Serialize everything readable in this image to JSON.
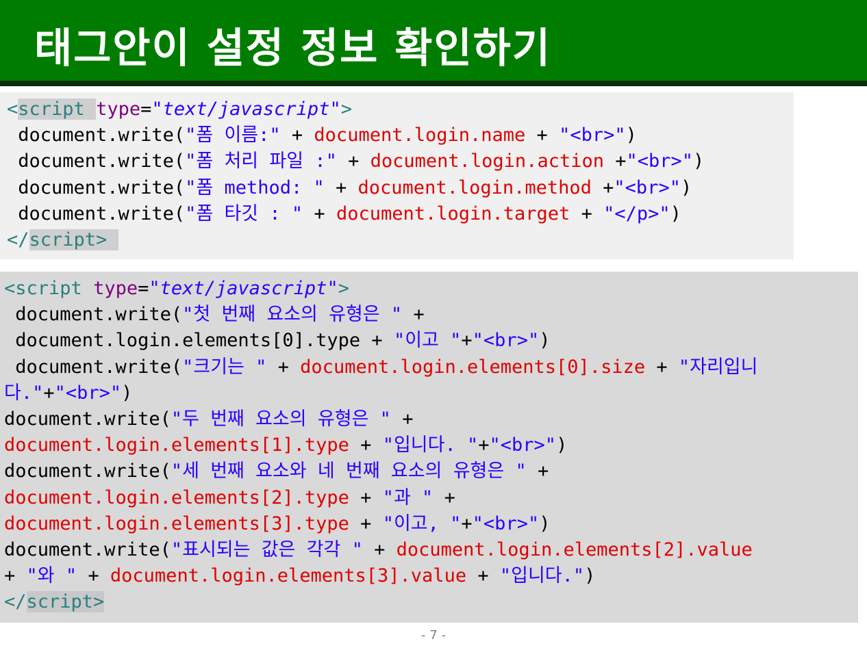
{
  "title": "태그안이 설정 정보 확인하기",
  "page_number": "- 7 -",
  "block1": [
    [
      {
        "t": "<",
        "c": "tag"
      },
      {
        "t": "script ",
        "c": "tagbg"
      },
      {
        "t": "type",
        "c": "attr"
      },
      {
        "t": "=",
        "c": ""
      },
      {
        "t": "\"text/javascript\"",
        "c": "val"
      },
      {
        "t": ">",
        "c": "tag"
      }
    ],
    [
      {
        "t": " document.write(",
        "c": ""
      },
      {
        "t": "\"폼 이름:\"",
        "c": "str"
      },
      {
        "t": " + ",
        "c": ""
      },
      {
        "t": "document.login.name",
        "c": "red"
      },
      {
        "t": " + ",
        "c": ""
      },
      {
        "t": "\"<br>\"",
        "c": "str"
      },
      {
        "t": ")",
        "c": ""
      }
    ],
    [
      {
        "t": " document.write(",
        "c": ""
      },
      {
        "t": "\"폼 처리 파일 :\"",
        "c": "str"
      },
      {
        "t": " + ",
        "c": ""
      },
      {
        "t": "document.login.action",
        "c": "red"
      },
      {
        "t": " +",
        "c": ""
      },
      {
        "t": "\"<br>\"",
        "c": "str"
      },
      {
        "t": ")",
        "c": ""
      }
    ],
    [
      {
        "t": " document.write(",
        "c": ""
      },
      {
        "t": "\"폼 method: \"",
        "c": "str"
      },
      {
        "t": " + ",
        "c": ""
      },
      {
        "t": "document.login.method",
        "c": "red"
      },
      {
        "t": " +",
        "c": ""
      },
      {
        "t": "\"<br>\"",
        "c": "str"
      },
      {
        "t": ")",
        "c": ""
      }
    ],
    [
      {
        "t": " document.write(",
        "c": ""
      },
      {
        "t": "\"폼 타깃 : \"",
        "c": "str"
      },
      {
        "t": " + ",
        "c": ""
      },
      {
        "t": "document.login.target",
        "c": "red"
      },
      {
        "t": " + ",
        "c": ""
      },
      {
        "t": "\"</p>\"",
        "c": "str"
      },
      {
        "t": ")",
        "c": ""
      }
    ],
    [
      {
        "t": "</",
        "c": "tag"
      },
      {
        "t": "script> ",
        "c": "tagbg"
      }
    ]
  ],
  "block2": [
    [
      {
        "t": "<",
        "c": "tag"
      },
      {
        "t": "script ",
        "c": "tag"
      },
      {
        "t": "type",
        "c": "attr"
      },
      {
        "t": "=",
        "c": ""
      },
      {
        "t": "\"text/javascript\"",
        "c": "val"
      },
      {
        "t": ">",
        "c": "tag"
      }
    ],
    [
      {
        "t": " document.write(",
        "c": ""
      },
      {
        "t": "\"첫 번째 요소의 유형은 \"",
        "c": "str"
      },
      {
        "t": " +",
        "c": ""
      }
    ],
    [
      {
        "t": " document.login.elements[0].type + ",
        "c": ""
      },
      {
        "t": "\"이고 \"",
        "c": "str"
      },
      {
        "t": "+",
        "c": ""
      },
      {
        "t": "\"<br>\"",
        "c": "str"
      },
      {
        "t": ")",
        "c": ""
      }
    ],
    [
      {
        "t": " document.write(",
        "c": ""
      },
      {
        "t": "\"크기는 \"",
        "c": "str"
      },
      {
        "t": " + ",
        "c": ""
      },
      {
        "t": "document.login.elements[0].size",
        "c": "red"
      },
      {
        "t": " + ",
        "c": ""
      },
      {
        "t": "\"자리입니",
        "c": "str"
      }
    ],
    [
      {
        "t": "다.\"",
        "c": "str"
      },
      {
        "t": "+",
        "c": ""
      },
      {
        "t": "\"<br>\"",
        "c": "str"
      },
      {
        "t": ")",
        "c": ""
      }
    ],
    [
      {
        "t": "document.write(",
        "c": ""
      },
      {
        "t": "\"두 번째 요소의 유형은 \"",
        "c": "str"
      },
      {
        "t": " +",
        "c": ""
      }
    ],
    [
      {
        "t": "document.login.elements[1].type",
        "c": "red"
      },
      {
        "t": " + ",
        "c": ""
      },
      {
        "t": "\"입니다. \"",
        "c": "str"
      },
      {
        "t": "+",
        "c": ""
      },
      {
        "t": "\"<br>\"",
        "c": "str"
      },
      {
        "t": ")",
        "c": ""
      }
    ],
    [
      {
        "t": "document.write(",
        "c": ""
      },
      {
        "t": "\"세 번째 요소와 네 번째 요소의 유형은 \"",
        "c": "str"
      },
      {
        "t": " +",
        "c": ""
      }
    ],
    [
      {
        "t": "document.login.elements[2].type",
        "c": "red"
      },
      {
        "t": " + ",
        "c": ""
      },
      {
        "t": "\"과 \"",
        "c": "str"
      },
      {
        "t": " +",
        "c": ""
      }
    ],
    [
      {
        "t": "document.login.elements[3].type",
        "c": "red"
      },
      {
        "t": " + ",
        "c": ""
      },
      {
        "t": "\"이고, \"",
        "c": "str"
      },
      {
        "t": "+",
        "c": ""
      },
      {
        "t": "\"<br>\"",
        "c": "str"
      },
      {
        "t": ")",
        "c": ""
      }
    ],
    [
      {
        "t": "document.write(",
        "c": ""
      },
      {
        "t": "\"표시되는 값은 각각 \"",
        "c": "str"
      },
      {
        "t": " + ",
        "c": ""
      },
      {
        "t": "document.login.elements[2].value",
        "c": "red"
      }
    ],
    [
      {
        "t": "+ ",
        "c": ""
      },
      {
        "t": "\"와 \"",
        "c": "str"
      },
      {
        "t": " + ",
        "c": ""
      },
      {
        "t": "document.login.elements[3].value",
        "c": "red"
      },
      {
        "t": " + ",
        "c": ""
      },
      {
        "t": "\"입니다.\"",
        "c": "str"
      },
      {
        "t": ")",
        "c": ""
      }
    ],
    [
      {
        "t": "</",
        "c": "tag"
      },
      {
        "t": "script>",
        "c": "tagbg"
      }
    ]
  ]
}
